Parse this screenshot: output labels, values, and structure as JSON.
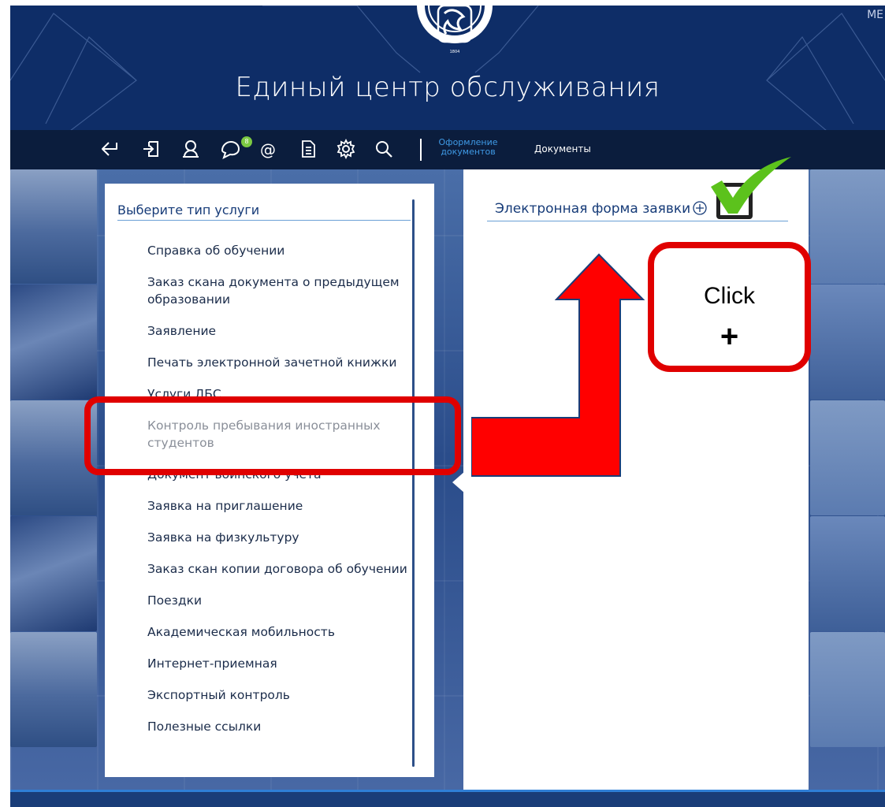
{
  "header": {
    "site_title": "Единый центр обслуживания",
    "corner_text": "МЕ"
  },
  "toolbar": {
    "icons": [
      "back-icon",
      "login-icon",
      "user-icon",
      "messages-icon",
      "email-icon",
      "document-icon",
      "settings-icon",
      "search-icon"
    ],
    "message_badge": "8",
    "tab_active": "Оформление документов",
    "tab_documents": "Документы",
    "active_color": "#3f9ae6"
  },
  "left_panel": {
    "title": "Выберите тип услуги",
    "items": [
      "Справка об обучении",
      "Заказ скана документа о предыдущем образовании",
      "Заявление",
      "Печать электронной зачетной книжки",
      "Услуги ДБС",
      "Контроль пребывания иностранных студентов",
      "Документ воинского учета",
      "Заявка на приглашение",
      "Заявка на физкультуру",
      "Заказ скан копии договора об обучении",
      "Поездки",
      "Академическая мобильность",
      "Интернет-приемная",
      "Экспортный контроль",
      "Полезные ссылки"
    ]
  },
  "right_panel": {
    "form_title": "Электронная форма заявки",
    "plus_icon": "plus-circle-icon"
  },
  "annotation": {
    "callout_text": "Click",
    "callout_symbol": "+",
    "highlight_color": "#e00000",
    "check_color": "#5cc21c"
  }
}
